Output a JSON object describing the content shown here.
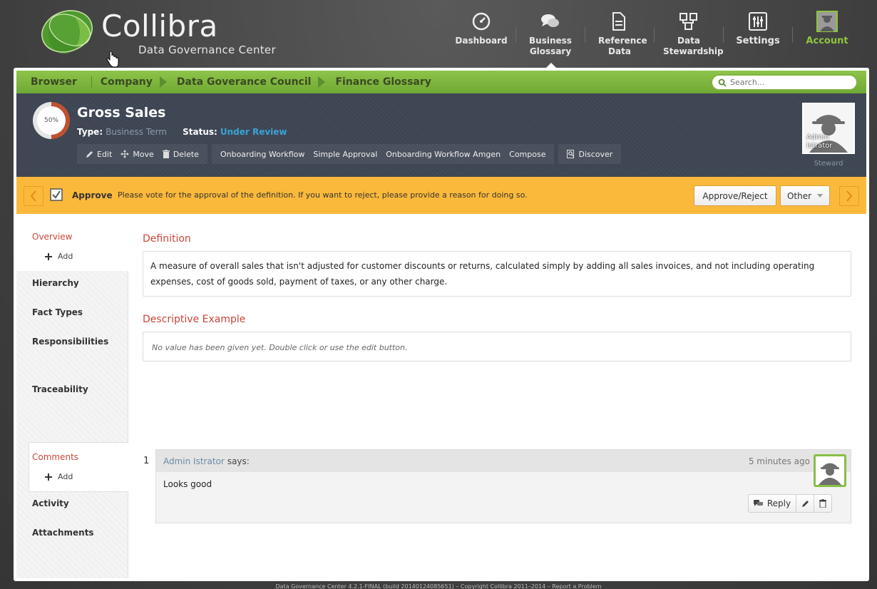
{
  "brand": {
    "name": "Collibra",
    "subtitle": "Data Governance Center"
  },
  "topnav": [
    {
      "id": "dashboard",
      "label": "Dashboard"
    },
    {
      "id": "business-glossary",
      "label": "Business Glossary"
    },
    {
      "id": "reference-data",
      "label": "Reference Data"
    },
    {
      "id": "data-stewardship",
      "label": "Data Stewardship"
    },
    {
      "id": "settings",
      "label": "Settings"
    },
    {
      "id": "account",
      "label": "Account"
    }
  ],
  "breadcrumb": [
    "Browser",
    "Company",
    "Data Goverance Council",
    "Finance Glossary"
  ],
  "search": {
    "placeholder": "Search..."
  },
  "asset": {
    "progress": "50%",
    "title": "Gross Sales",
    "type_label": "Type:",
    "type_value": "Business Term",
    "status_label": "Status:",
    "status_value": "Under Review",
    "actions": {
      "edit": "Edit",
      "move": "Move",
      "delete": "Delete",
      "workflows": [
        "Onboarding Workflow",
        "Simple Approval",
        "Onboarding Workflow Amgen",
        "Compose"
      ],
      "discover": "Discover"
    },
    "steward": {
      "name_line1": "Admin",
      "name_line2": "Istrator",
      "role": "Steward"
    }
  },
  "task": {
    "title": "Approve",
    "message": "Please vote for the approval of the definition. If you want to reject, please provide a reason for doing so.",
    "approve_button": "Approve/Reject",
    "other_button": "Other"
  },
  "leftnav": {
    "overview": "Overview",
    "add": "Add",
    "hierarchy": "Hierarchy",
    "fact_types": "Fact Types",
    "responsibilities": "Responsibilities",
    "traceability": "Traceability",
    "comments": "Comments",
    "activity": "Activity",
    "attachments": "Attachments"
  },
  "content": {
    "definition_title": "Definition",
    "definition_text": "A measure of overall sales that isn't adjusted for customer discounts or returns, calculated simply by adding all sales invoices, and not including operating expenses, cost of goods sold, payment of taxes, or any other charge.",
    "example_title": "Descriptive Example",
    "example_text": "No value has been given yet. Double click or use the edit button."
  },
  "comment": {
    "number": "1",
    "author": "Admin Istrator",
    "says": "says:",
    "time": "5 minutes ago",
    "body": "Looks good",
    "reply": "Reply"
  },
  "footer": "Data Governance Center 4.2.1-FINAL (build 20140124085651) – Copyright Collibra 2011–2014 – Report a Problem",
  "colors": {
    "green": "#8ec44a",
    "orange": "#fbb93b",
    "red": "#c9463a",
    "blue": "#3ba3d6",
    "header": "#3c4452"
  }
}
